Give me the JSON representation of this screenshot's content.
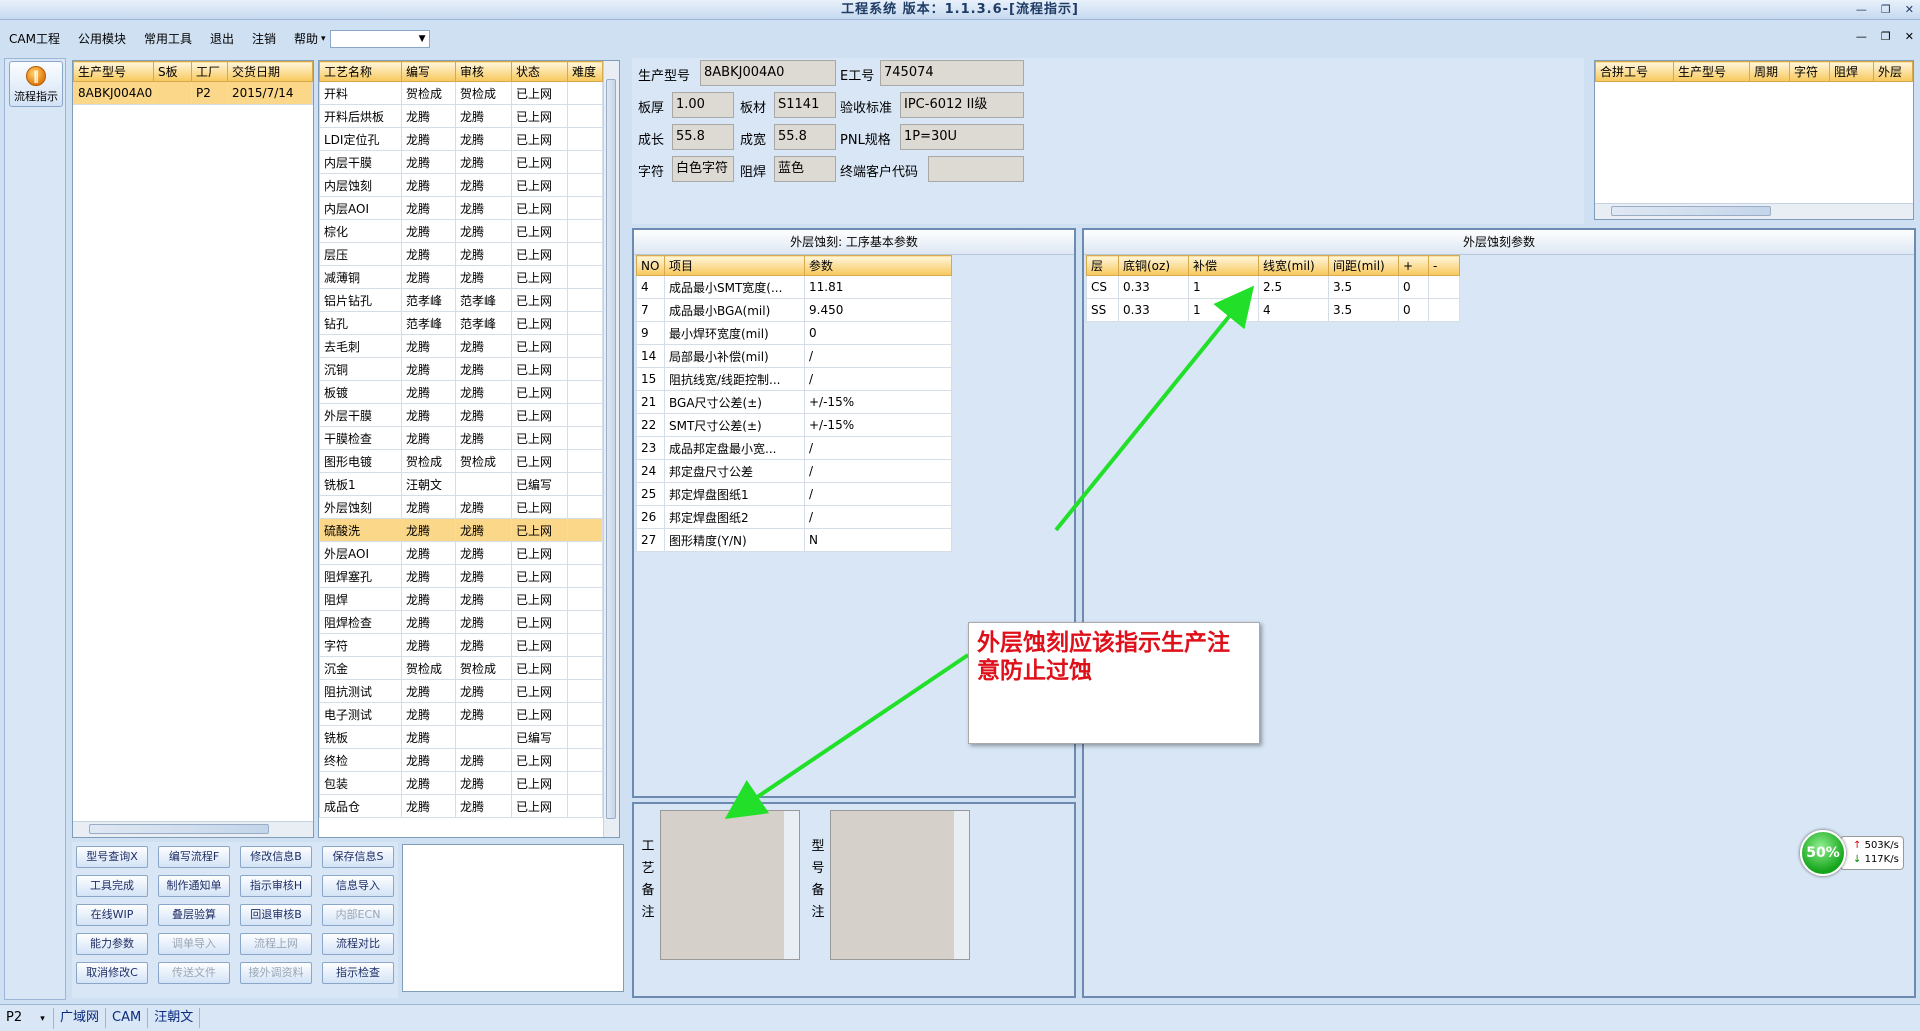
{
  "window": {
    "title": "工程系统 版本：1.1.3.6-[流程指示]",
    "controls": [
      "—",
      "❐",
      "✕"
    ],
    "mdi_controls": [
      "—",
      "❐",
      "✕"
    ]
  },
  "menu": {
    "items": [
      "CAM工程",
      "公用模块",
      "常用工具",
      "退出",
      "注销",
      "帮助"
    ],
    "combo_value": ""
  },
  "nav": {
    "button_label": "流程指示",
    "icon": "flow-indicator-icon"
  },
  "orders": {
    "columns": [
      "生产型号",
      "S板",
      "工厂",
      "交货日期"
    ],
    "rows": [
      [
        "8ABKJ004A0",
        "",
        "P2",
        "2015/7/14"
      ]
    ]
  },
  "processes": {
    "columns": [
      "工艺名称",
      "编写",
      "审核",
      "状态",
      "难度"
    ],
    "selected_index": 19,
    "rows": [
      [
        "开料",
        "贺检成",
        "贺检成",
        "已上网",
        ""
      ],
      [
        "开料后烘板",
        "龙腾",
        "龙腾",
        "已上网",
        ""
      ],
      [
        "LDI定位孔",
        "龙腾",
        "龙腾",
        "已上网",
        ""
      ],
      [
        "内层干膜",
        "龙腾",
        "龙腾",
        "已上网",
        ""
      ],
      [
        "内层蚀刻",
        "龙腾",
        "龙腾",
        "已上网",
        ""
      ],
      [
        "内层AOI",
        "龙腾",
        "龙腾",
        "已上网",
        ""
      ],
      [
        "棕化",
        "龙腾",
        "龙腾",
        "已上网",
        ""
      ],
      [
        "层压",
        "龙腾",
        "龙腾",
        "已上网",
        ""
      ],
      [
        "减薄铜",
        "龙腾",
        "龙腾",
        "已上网",
        ""
      ],
      [
        "铝片钻孔",
        "范孝峰",
        "范孝峰",
        "已上网",
        ""
      ],
      [
        "钻孔",
        "范孝峰",
        "范孝峰",
        "已上网",
        ""
      ],
      [
        "去毛刺",
        "龙腾",
        "龙腾",
        "已上网",
        ""
      ],
      [
        "沉铜",
        "龙腾",
        "龙腾",
        "已上网",
        ""
      ],
      [
        "板镀",
        "龙腾",
        "龙腾",
        "已上网",
        ""
      ],
      [
        "外层干膜",
        "龙腾",
        "龙腾",
        "已上网",
        ""
      ],
      [
        "干膜检查",
        "龙腾",
        "龙腾",
        "已上网",
        ""
      ],
      [
        "图形电镀",
        "贺检成",
        "贺检成",
        "已上网",
        ""
      ],
      [
        "铣板1",
        "汪朝文",
        "",
        "已编写",
        ""
      ],
      [
        "外层蚀刻",
        "龙腾",
        "龙腾",
        "已上网",
        ""
      ],
      [
        "硫酸洗",
        "龙腾",
        "龙腾",
        "已上网",
        ""
      ],
      [
        "外层AOI",
        "龙腾",
        "龙腾",
        "已上网",
        ""
      ],
      [
        "阻焊塞孔",
        "龙腾",
        "龙腾",
        "已上网",
        ""
      ],
      [
        "阻焊",
        "龙腾",
        "龙腾",
        "已上网",
        ""
      ],
      [
        "阻焊检查",
        "龙腾",
        "龙腾",
        "已上网",
        ""
      ],
      [
        "字符",
        "龙腾",
        "龙腾",
        "已上网",
        ""
      ],
      [
        "沉金",
        "贺检成",
        "贺检成",
        "已上网",
        ""
      ],
      [
        "阻抗测试",
        "龙腾",
        "龙腾",
        "已上网",
        ""
      ],
      [
        "电子测试",
        "龙腾",
        "龙腾",
        "已上网",
        ""
      ],
      [
        "铣板",
        "龙腾",
        "",
        "已编写",
        ""
      ],
      [
        "终检",
        "龙腾",
        "龙腾",
        "已上网",
        ""
      ],
      [
        "包装",
        "龙腾",
        "龙腾",
        "已上网",
        ""
      ],
      [
        "成品仓",
        "龙腾",
        "龙腾",
        "已上网",
        ""
      ]
    ]
  },
  "buttons": [
    {
      "label": "型号查询X",
      "enabled": true
    },
    {
      "label": "编写流程F",
      "enabled": true
    },
    {
      "label": "修改信息B",
      "enabled": true
    },
    {
      "label": "保存信息S",
      "enabled": true
    },
    {
      "label": "工具完成",
      "enabled": true
    },
    {
      "label": "制作通知单",
      "enabled": true
    },
    {
      "label": "指示审核H",
      "enabled": true
    },
    {
      "label": "信息导入",
      "enabled": true
    },
    {
      "label": "在线WIP",
      "enabled": true
    },
    {
      "label": "叠层验算",
      "enabled": true
    },
    {
      "label": "回退审核B",
      "enabled": true
    },
    {
      "label": "内部ECN",
      "enabled": false
    },
    {
      "label": "能力参数",
      "enabled": true
    },
    {
      "label": "调单导入",
      "enabled": false
    },
    {
      "label": "流程上网",
      "enabled": false
    },
    {
      "label": "流程对比",
      "enabled": true
    },
    {
      "label": "取消修改C",
      "enabled": true
    },
    {
      "label": "传送文件",
      "enabled": false
    },
    {
      "label": "接外调资料",
      "enabled": false
    },
    {
      "label": "指示检查",
      "enabled": true
    }
  ],
  "info": {
    "model_label": "生产型号",
    "model_value": "8ABKJ004A0",
    "e_label": "E工号",
    "e_value": "745074",
    "thick_label": "板厚",
    "thick_value": "1.00",
    "material_label": "板材",
    "material_value": "S1141",
    "std_label": "验收标准",
    "std_value": "IPC-6012 II级",
    "len_label": "成长",
    "len_value": "55.8",
    "wid_label": "成宽",
    "wid_value": "55.8",
    "pnl_label": "PNL规格",
    "pnl_value": "1P=30U",
    "char_label": "字符",
    "char_value": "白色字符",
    "mask_label": "阻焊",
    "mask_value": "蓝色",
    "cust_label": "终端客户代码",
    "cust_value": ""
  },
  "combine": {
    "columns": [
      "合拼工号",
      "生产型号",
      "周期",
      "字符",
      "阻焊",
      "外层"
    ]
  },
  "params": {
    "title": "外层蚀刻: 工序基本参数",
    "columns": [
      "NO",
      "项目",
      "参数"
    ],
    "rows": [
      [
        "4",
        "成品最小SMT宽度(...",
        "11.81"
      ],
      [
        "7",
        "成品最小BGA(mil)",
        "9.450"
      ],
      [
        "9",
        "最小焊环宽度(mil)",
        "0"
      ],
      [
        "14",
        "局部最小补偿(mil)",
        "/"
      ],
      [
        "15",
        "阻抗线宽/线距控制...",
        "/"
      ],
      [
        "21",
        "BGA尺寸公差(±)",
        "+/-15%"
      ],
      [
        "22",
        "SMT尺寸公差(±)",
        "+/-15%"
      ],
      [
        "23",
        "成品邦定盘最小宽...",
        "/"
      ],
      [
        "24",
        "邦定盘尺寸公差",
        "/"
      ],
      [
        "25",
        "邦定焊盘图纸1",
        "/"
      ],
      [
        "26",
        "邦定焊盘图纸2",
        "/"
      ],
      [
        "27",
        "图形精度(Y/N)",
        "N"
      ]
    ]
  },
  "etch": {
    "title": "外层蚀刻参数",
    "columns": [
      "层",
      "底铜(oz)",
      "补偿",
      "线宽(mil)",
      "间距(mil)",
      "+",
      "-"
    ],
    "rows": [
      [
        "CS",
        "0.33",
        "1",
        "2.5",
        "3.5",
        "0",
        ""
      ],
      [
        "SS",
        "0.33",
        "1",
        "4",
        "3.5",
        "0",
        ""
      ]
    ]
  },
  "memo": {
    "process_label": "工艺备注",
    "model_label": "型号备注"
  },
  "callout": {
    "text": "外层蚀刻应该指示生产注意防止过蚀"
  },
  "status": {
    "factory": "P2",
    "cells": [
      "广域网",
      "CAM",
      "汪朝文"
    ]
  },
  "net": {
    "percent": "50%",
    "up": "503K/s",
    "down": "117K/s"
  },
  "colors": {
    "accent": "#f7c85a",
    "arrow": "#22e02a",
    "callout_text": "#e0101a"
  }
}
